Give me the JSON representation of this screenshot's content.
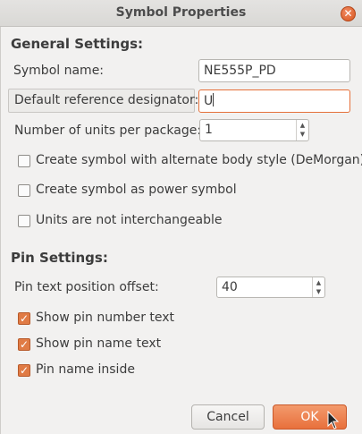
{
  "window": {
    "title": "Symbol Properties",
    "close_icon": "close-icon"
  },
  "general": {
    "heading": "General Settings:",
    "symbol_name_label": "Symbol name:",
    "symbol_name_value": "NE555P_PD",
    "ref_label": "Default reference designator:",
    "ref_value": "U",
    "units_label": "Number of units per package:",
    "units_value": "1",
    "demorgan_label": "Create symbol with alternate body style (DeMorgan)",
    "demorgan_checked": false,
    "power_label": "Create symbol as power symbol",
    "power_checked": false,
    "interchange_label": "Units are not interchangeable",
    "interchange_checked": false
  },
  "pins": {
    "heading": "Pin Settings:",
    "offset_label": "Pin text position offset:",
    "offset_value": "40",
    "show_number_label": "Show pin number text",
    "show_number_checked": true,
    "show_name_label": "Show pin name text",
    "show_name_checked": true,
    "name_inside_label": "Pin name inside",
    "name_inside_checked": true
  },
  "buttons": {
    "cancel": "Cancel",
    "ok": "OK"
  },
  "colors": {
    "accent": "#e8703c",
    "background": "#f2f1f0"
  }
}
